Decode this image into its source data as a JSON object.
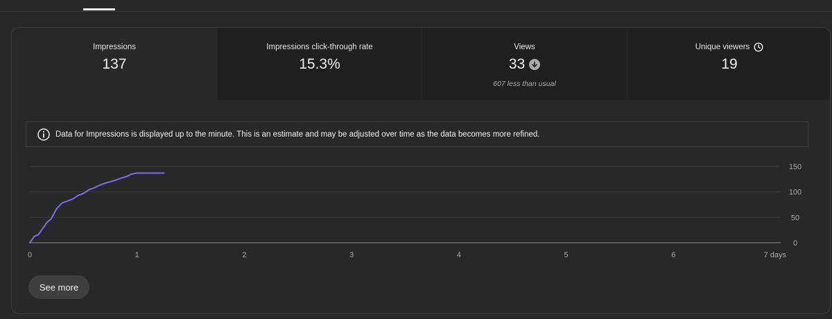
{
  "metrics": [
    {
      "label": "Impressions",
      "value": "137",
      "note": ""
    },
    {
      "label": "Impressions click-through rate",
      "value": "15.3%",
      "note": ""
    },
    {
      "label": "Views",
      "value": "33",
      "note": "607 less than usual",
      "indicator_icon": "arrow-down-circle-icon"
    },
    {
      "label": "Unique viewers",
      "value": "19",
      "note": "",
      "label_icon": "clock-icon"
    }
  ],
  "active_metric": "Impressions",
  "info": {
    "icon": "info-icon",
    "text": "Data for Impressions is displayed up to the minute. This is an estimate and may be adjusted over time as the data becomes more refined."
  },
  "chart_data": {
    "type": "line",
    "title": "",
    "xlabel": "",
    "ylabel": "",
    "x_ticks": [
      "0",
      "1",
      "2",
      "3",
      "4",
      "5",
      "6",
      "7 days"
    ],
    "x_tick_values": [
      0,
      1,
      2,
      3,
      4,
      5,
      6,
      7
    ],
    "y_ticks": [
      "0",
      "50",
      "100",
      "150"
    ],
    "y_tick_values": [
      0,
      50,
      100,
      150
    ],
    "xlim": [
      0,
      7
    ],
    "ylim": [
      0,
      150
    ],
    "grid": true,
    "series_color": "#7b6cf6",
    "series": [
      {
        "name": "",
        "x": [
          0,
          0.04,
          0.08,
          0.12,
          0.16,
          0.2,
          0.25,
          0.3,
          0.35,
          0.4,
          0.45,
          0.5,
          0.55,
          0.6,
          0.65,
          0.7,
          0.75,
          0.8,
          0.85,
          0.9,
          0.95,
          1.0,
          1.1,
          1.2,
          1.25
        ],
        "y": [
          0,
          12,
          16,
          28,
          40,
          47,
          67,
          78,
          82,
          86,
          93,
          97,
          104,
          108,
          113,
          117,
          120,
          123,
          127,
          130,
          135,
          137,
          137,
          137,
          137
        ]
      }
    ]
  },
  "see_more_label": "See more"
}
